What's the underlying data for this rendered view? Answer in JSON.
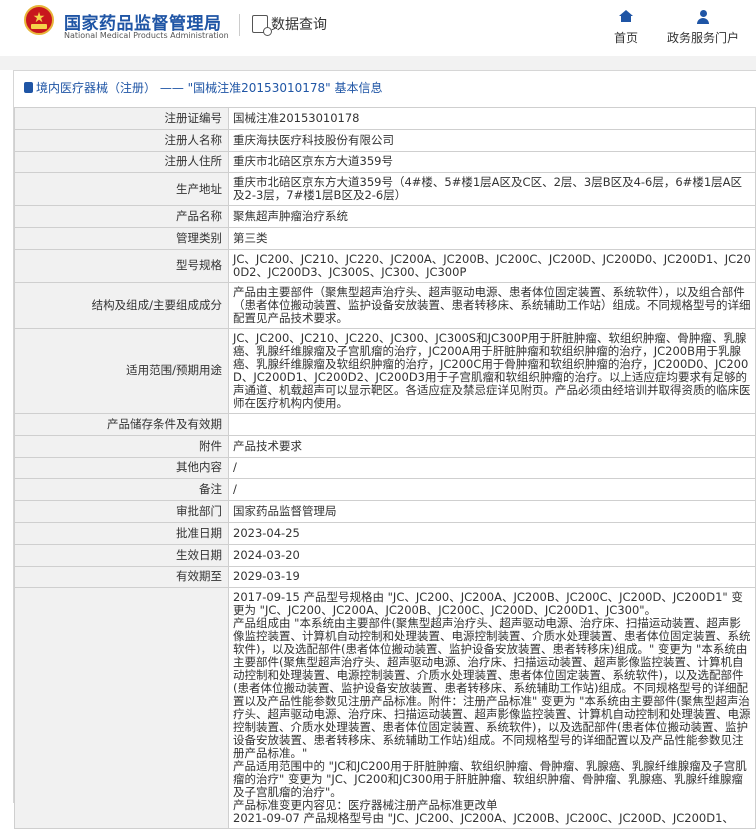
{
  "header": {
    "org_name_cn": "国家药品监督管理局",
    "org_name_en": "National Medical Products Administration",
    "data_query_label": "数据查询",
    "nav": [
      {
        "label": "首页",
        "icon": "home-icon"
      },
      {
        "label": "政务服务门户",
        "icon": "user-icon"
      }
    ]
  },
  "breadcrumb": "境内医疗器械（注册） —— \"国械注准20153010178\" 基本信息",
  "details": [
    {
      "label": "注册证编号",
      "value": "国械注准20153010178"
    },
    {
      "label": "注册人名称",
      "value": "重庆海扶医疗科技股份有限公司"
    },
    {
      "label": "注册人住所",
      "value": "重庆市北碚区京东方大道359号"
    },
    {
      "label": "生产地址",
      "value": "重庆市北碚区京东方大道359号（4#楼、5#楼1层A区及C区、2层、3层B区及4-6层，6#楼1层A区及2-3层，7#楼1层B区及2-6层）"
    },
    {
      "label": "产品名称",
      "value": "聚焦超声肿瘤治疗系统"
    },
    {
      "label": "管理类别",
      "value": "第三类"
    },
    {
      "label": "型号规格",
      "value": "JC、JC200、JC210、JC220、JC200A、JC200B、JC200C、JC200D、JC200D0、JC200D1、JC200D2、JC200D3、JC300S、JC300、JC300P"
    },
    {
      "label": "结构及组成/主要组成成分",
      "value": "产品由主要部件（聚焦型超声治疗头、超声驱动电源、患者体位固定装置、系统软件），以及组合部件（患者体位搬动装置、监护设备安放装置、患者转移床、系统辅助工作站）组成。不同规格型号的详细配置见产品技术要求。"
    },
    {
      "label": "适用范围/预期用途",
      "value": "JC、JC200、JC210、JC220、JC300、JC300S和JC300P用于肝脏肿瘤、软组织肿瘤、骨肿瘤、乳腺癌、乳腺纤维腺瘤及子宫肌瘤的治疗，JC200A用于肝脏肿瘤和软组织肿瘤的治疗，JC200B用于乳腺癌、乳腺纤维腺瘤及软组织肿瘤的治疗，JC200C用于骨肿瘤和软组织肿瘤的治疗，JC200D0、JC200D、JC200D1、JC200D2、JC200D3用于子宫肌瘤和软组织肿瘤的治疗。以上适应症均要求有足够的声通道、机载超声可以显示靶区。各适应症及禁忌症详见附页。产品必须由经培训并取得资质的临床医师在医疗机构内使用。"
    },
    {
      "label": "产品储存条件及有效期",
      "value": ""
    },
    {
      "label": "附件",
      "value": "产品技术要求"
    },
    {
      "label": "其他内容",
      "value": "/"
    },
    {
      "label": "备注",
      "value": "/"
    },
    {
      "label": "审批部门",
      "value": "国家药品监督管理局"
    },
    {
      "label": "批准日期",
      "value": "2023-04-25"
    },
    {
      "label": "生效日期",
      "value": "2024-03-20"
    },
    {
      "label": "有效期至",
      "value": "2029-03-19"
    },
    {
      "label": "",
      "value": "2017-09-15 产品型号规格由 \"JC、JC200、JC200A、JC200B、JC200C、JC200D、JC200D1\" 变更为 \"JC、JC200、JC200A、JC200B、JC200C、JC200D、JC200D1、JC300\"。\n产品组成由 \"本系统由主要部件(聚焦型超声治疗头、超声驱动电源、治疗床、扫描运动装置、超声影像监控装置、计算机自动控制和处理装置、电源控制装置、介质水处理装置、患者体位固定装置、系统软件)，以及选配部件(患者体位搬动装置、监护设备安放装置、患者转移床)组成。\" 变更为 \"本系统由主要部件(聚焦型超声治疗头、超声驱动电源、治疗床、扫描运动装置、超声影像监控装置、计算机自动控制和处理装置、电源控制装置、介质水处理装置、患者体位固定装置、系统软件)，以及选配部件(患者体位搬动装置、监护设备安放装置、患者转移床、系统辅助工作站)组成。不同规格型号的详细配置以及产品性能参数见注册产品标准。附件：注册产品标准\" 变更为 \"本系统由主要部件(聚焦型超声治疗头、超声驱动电源、治疗床、扫描运动装置、超声影像监控装置、计算机自动控制和处理装置、电源控制装置、介质水处理装置、患者体位固定装置、系统软件)，以及选配部件(患者体位搬动装置、监护设备安放装置、患者转移床、系统辅助工作站)组成。不同规格型号的详细配置以及产品性能参数见注册产品标准。\"\n产品适用范围中的 \"JC和JC200用于肝脏肿瘤、软组织肿瘤、骨肿瘤、乳腺癌、乳腺纤维腺瘤及子宫肌瘤的治疗\" 变更为 \"JC、JC200和JC300用于肝脏肿瘤、软组织肿瘤、骨肿瘤、乳腺癌、乳腺纤维腺瘤及子宫肌瘤的治疗\"。\n产品标准变更内容见：医疗器械注册产品标准更改单\n2021-09-07 产品规格型号由 \"JC、JC200、JC200A、JC200B、JC200C、JC200D、JC200D1、"
    }
  ]
}
